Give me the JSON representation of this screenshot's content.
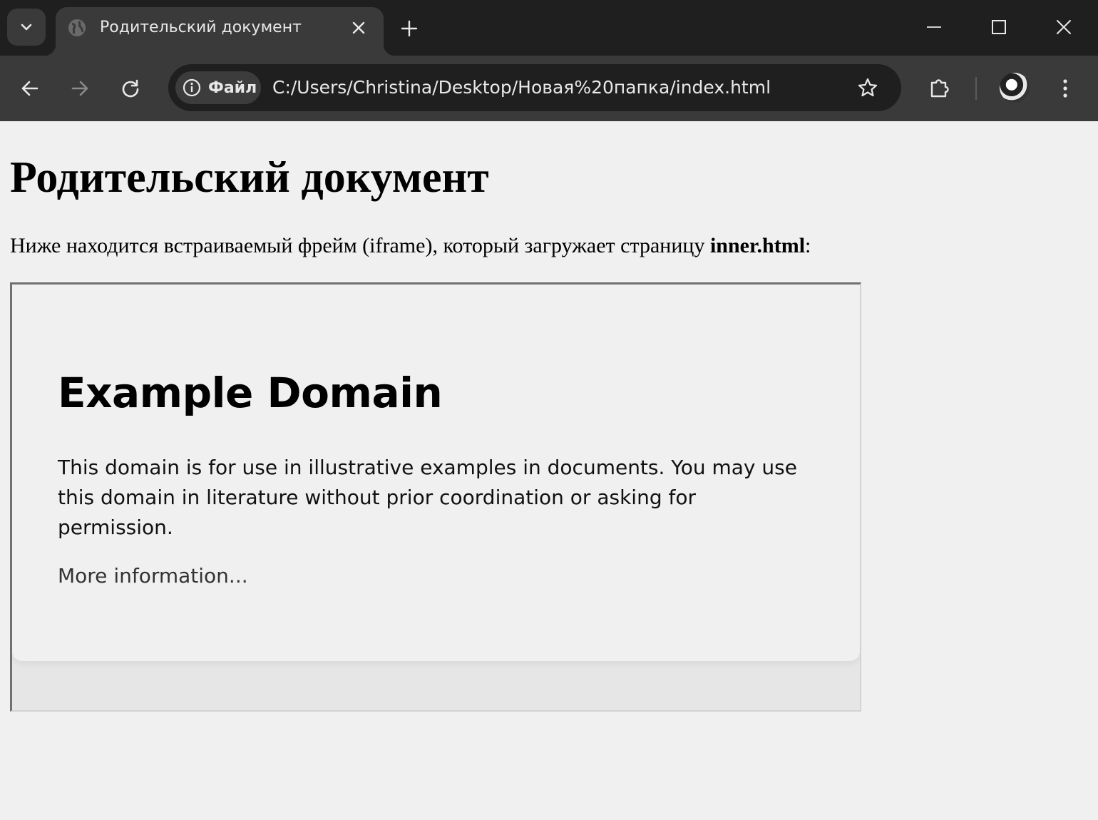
{
  "browser": {
    "tab": {
      "title": "Родительский документ"
    },
    "address_bar": {
      "site_chip_label": "Файл",
      "url": "C:/Users/Christina/Desktop/Новая%20папка/index.html"
    },
    "icons": {
      "tab_search": "chevron-down-icon",
      "favicon": "globe-icon",
      "tab_close": "close-icon",
      "new_tab": "plus-icon",
      "minimize": "minimize-icon",
      "maximize": "maximize-icon",
      "close_window": "close-icon",
      "back": "arrow-left-icon",
      "forward": "arrow-right-icon",
      "reload": "reload-icon",
      "site_info": "info-icon",
      "bookmark": "star-icon",
      "extensions": "puzzle-icon",
      "profile": "avatar",
      "menu": "more-vertical-icon"
    },
    "colors": {
      "tabstrip_bg": "#1f1f1f",
      "toolbar_bg": "#3a3a3a",
      "omnibox_bg": "#1f1f1f",
      "page_bg": "#f0f0f0"
    }
  },
  "page": {
    "title": "Родительский документ",
    "intro_prefix": "Ниже находится встраиваемый фрейм (iframe), который загружает страницу ",
    "intro_bold": "inner.html",
    "intro_suffix": ":",
    "iframe": {
      "title": "Example Domain",
      "text": "This domain is for use in illustrative examples in documents. You may use this domain in literature without prior coordination or asking for permission.",
      "link": "More information..."
    }
  }
}
